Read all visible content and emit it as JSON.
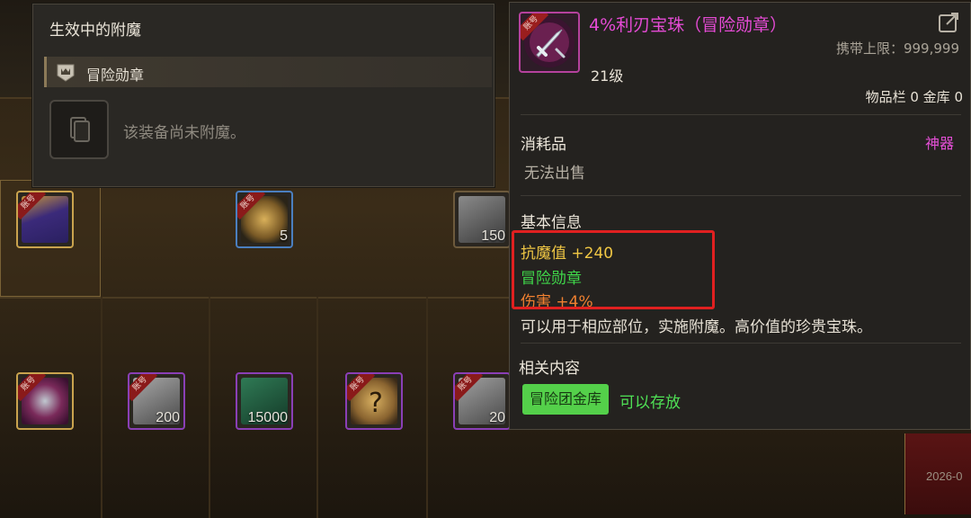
{
  "enchant_panel": {
    "title": "生效中的附魔",
    "category": "冒险勋章",
    "empty_message": "该装备尚未附魔。"
  },
  "tooltip": {
    "item_name": "4%利刃宝珠（冒险勋章）",
    "carry_limit": "携带上限：999,999",
    "level": "21级",
    "storage": "物品栏 0 金库 0",
    "type": "消耗品",
    "rarity": "神器",
    "sell_status": "无法出售",
    "basic_info_heading": "基本信息",
    "stats": {
      "magic_resist": "抗魔值 +240",
      "medal": "冒险勋章",
      "damage": "伤害 +4%"
    },
    "description": "可以用于相应部位，实施附魔。高价值的珍贵宝珠。",
    "related_heading": "相关内容",
    "guild_vault": "冒险团金库",
    "storable": "可以存放"
  },
  "inventory": {
    "account_tag": "账号",
    "slot_counts": {
      "medal_5": "5",
      "stone_150": "150",
      "stone_200": "200",
      "crystal_15000": "15000",
      "stone_20": "20"
    }
  },
  "footer": {
    "date_fragment": "2026-0"
  },
  "colors": {
    "rarity_artifact": "#e44fd6",
    "magic_resist": "#f0c744",
    "medal_text": "#3fd74a",
    "damage": "#f08030",
    "highlight_box": "#e02020",
    "vault_badge": "#54d04a"
  }
}
